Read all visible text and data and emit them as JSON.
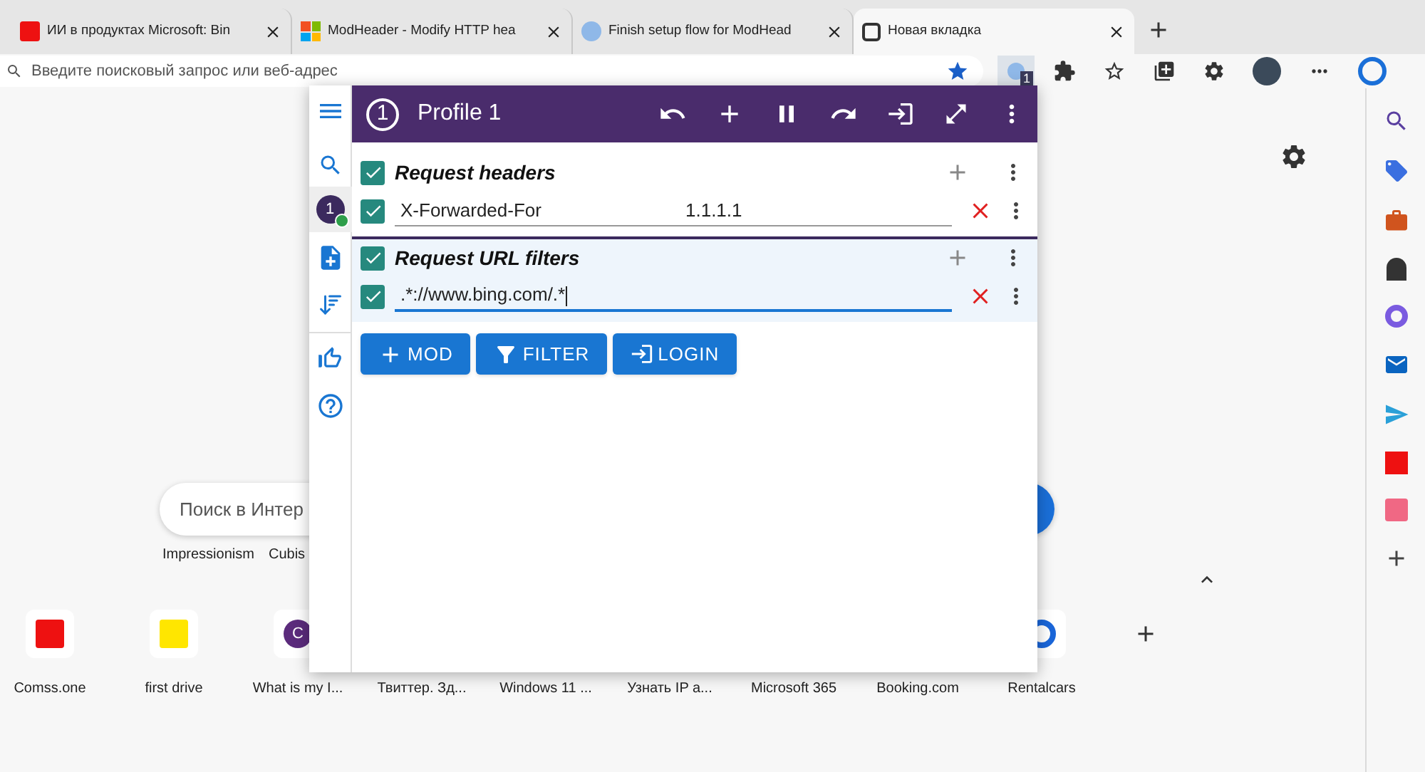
{
  "browser_tabs": [
    {
      "title": "ИИ в продуктах Microsoft: Bin",
      "selected": false,
      "kind": "red"
    },
    {
      "title": "ModHeader - Modify HTTP hea",
      "selected": false,
      "kind": "windows"
    },
    {
      "title": "Finish setup flow for ModHead",
      "selected": false,
      "kind": "snow"
    },
    {
      "title": "Новая вкладка",
      "selected": true,
      "kind": "page"
    }
  ],
  "address_bar": {
    "placeholder": "Введите поисковый запрос или веб-адрес"
  },
  "extension_badge": "1",
  "new_tab": {
    "search_placeholder": "Поиск в Интер",
    "trending": [
      "Impressionism",
      "Cubis"
    ],
    "quick_links": [
      {
        "label": "Comss.one",
        "kind": "red"
      },
      {
        "label": "first drive",
        "kind": "yellow"
      },
      {
        "label": "What is my I...",
        "kind": "letter",
        "letter": "C"
      },
      {
        "label": "Твиттер. Зд...",
        "kind": "none"
      },
      {
        "label": "Windows 11 ...",
        "kind": "none"
      },
      {
        "label": "Узнать IP a...",
        "kind": "none"
      },
      {
        "label": "Microsoft 365",
        "kind": "none"
      },
      {
        "label": "Booking.com",
        "kind": "none"
      },
      {
        "label": "Rentalcars",
        "kind": "blue"
      }
    ]
  },
  "popup": {
    "profile_number": "1",
    "profile_name": "Profile 1",
    "rail_badge": "1",
    "rail_badge_active": true,
    "sections": [
      {
        "title": "Request headers",
        "enabled": true,
        "highlighted": false,
        "rows": [
          {
            "enabled": true,
            "name": "X-Forwarded-For",
            "value": "1.1.1.1",
            "focused": false
          }
        ]
      },
      {
        "title": "Request URL filters",
        "enabled": true,
        "highlighted": true,
        "rows": [
          {
            "enabled": true,
            "name": ".*://www.bing.com/.*",
            "focused": true
          }
        ]
      }
    ],
    "buttons": [
      {
        "label": "MOD",
        "kind": "plus"
      },
      {
        "label": "FILTER",
        "kind": "filter"
      },
      {
        "label": "LOGIN",
        "kind": "login"
      }
    ]
  }
}
